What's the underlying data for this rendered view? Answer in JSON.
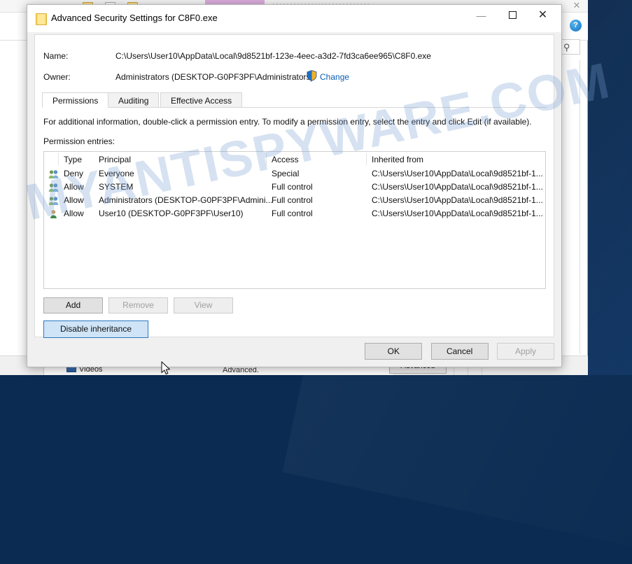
{
  "background": {
    "videos_label": "Videos",
    "special_text": "For special permissions or advanced settings, click Advanced.",
    "advanced_button": "Advanced",
    "help_glyph": "?",
    "close_glyph": "✕",
    "chevron_glyph": "⌄",
    "search_glyph": "⚲"
  },
  "watermark": {
    "text": "MYANTISPYWARE.COM"
  },
  "dialog": {
    "title": "Advanced Security Settings for C8F0.exe",
    "window_controls": {
      "minimize": "—",
      "maximize": "",
      "close": "✕"
    },
    "fields": {
      "name_label": "Name:",
      "name_value": "C:\\Users\\User10\\AppData\\Local\\9d8521bf-123e-4eec-a3d2-7fd3ca6ee965\\C8F0.exe",
      "owner_label": "Owner:",
      "owner_value": "Administrators (DESKTOP-G0PF3PF\\Administrators)",
      "change_link": "Change"
    },
    "tabs": [
      {
        "label": "Permissions",
        "active": true
      },
      {
        "label": "Auditing",
        "active": false
      },
      {
        "label": "Effective Access",
        "active": false
      }
    ],
    "info_text": "For additional information, double-click a permission entry. To modify a permission entry, select the entry and click Edit (if available).",
    "entries_label": "Permission entries:",
    "table": {
      "columns": [
        "Type",
        "Principal",
        "Access",
        "Inherited from"
      ],
      "rows": [
        {
          "icon": "group-icon",
          "type": "Deny",
          "principal": "Everyone",
          "access": "Special",
          "inherited": "C:\\Users\\User10\\AppData\\Local\\9d8521bf-1..."
        },
        {
          "icon": "group-icon",
          "type": "Allow",
          "principal": "SYSTEM",
          "access": "Full control",
          "inherited": "C:\\Users\\User10\\AppData\\Local\\9d8521bf-1..."
        },
        {
          "icon": "group-icon",
          "type": "Allow",
          "principal": "Administrators (DESKTOP-G0PF3PF\\Admini...",
          "access": "Full control",
          "inherited": "C:\\Users\\User10\\AppData\\Local\\9d8521bf-1..."
        },
        {
          "icon": "user-icon",
          "type": "Allow",
          "principal": "User10 (DESKTOP-G0PF3PF\\User10)",
          "access": "Full control",
          "inherited": "C:\\Users\\User10\\AppData\\Local\\9d8521bf-1..."
        }
      ]
    },
    "list_buttons": {
      "add": "Add",
      "remove": "Remove",
      "view": "View",
      "disable_inheritance": "Disable inheritance"
    },
    "footer_buttons": {
      "ok": "OK",
      "cancel": "Cancel",
      "apply": "Apply"
    }
  },
  "colors": {
    "link": "#0a5fb4",
    "hover_button_border": "#2a79c4",
    "hover_button_fill": "#cfe4f7",
    "desktop": "#0d3057",
    "watermark": "#78a0d2"
  }
}
